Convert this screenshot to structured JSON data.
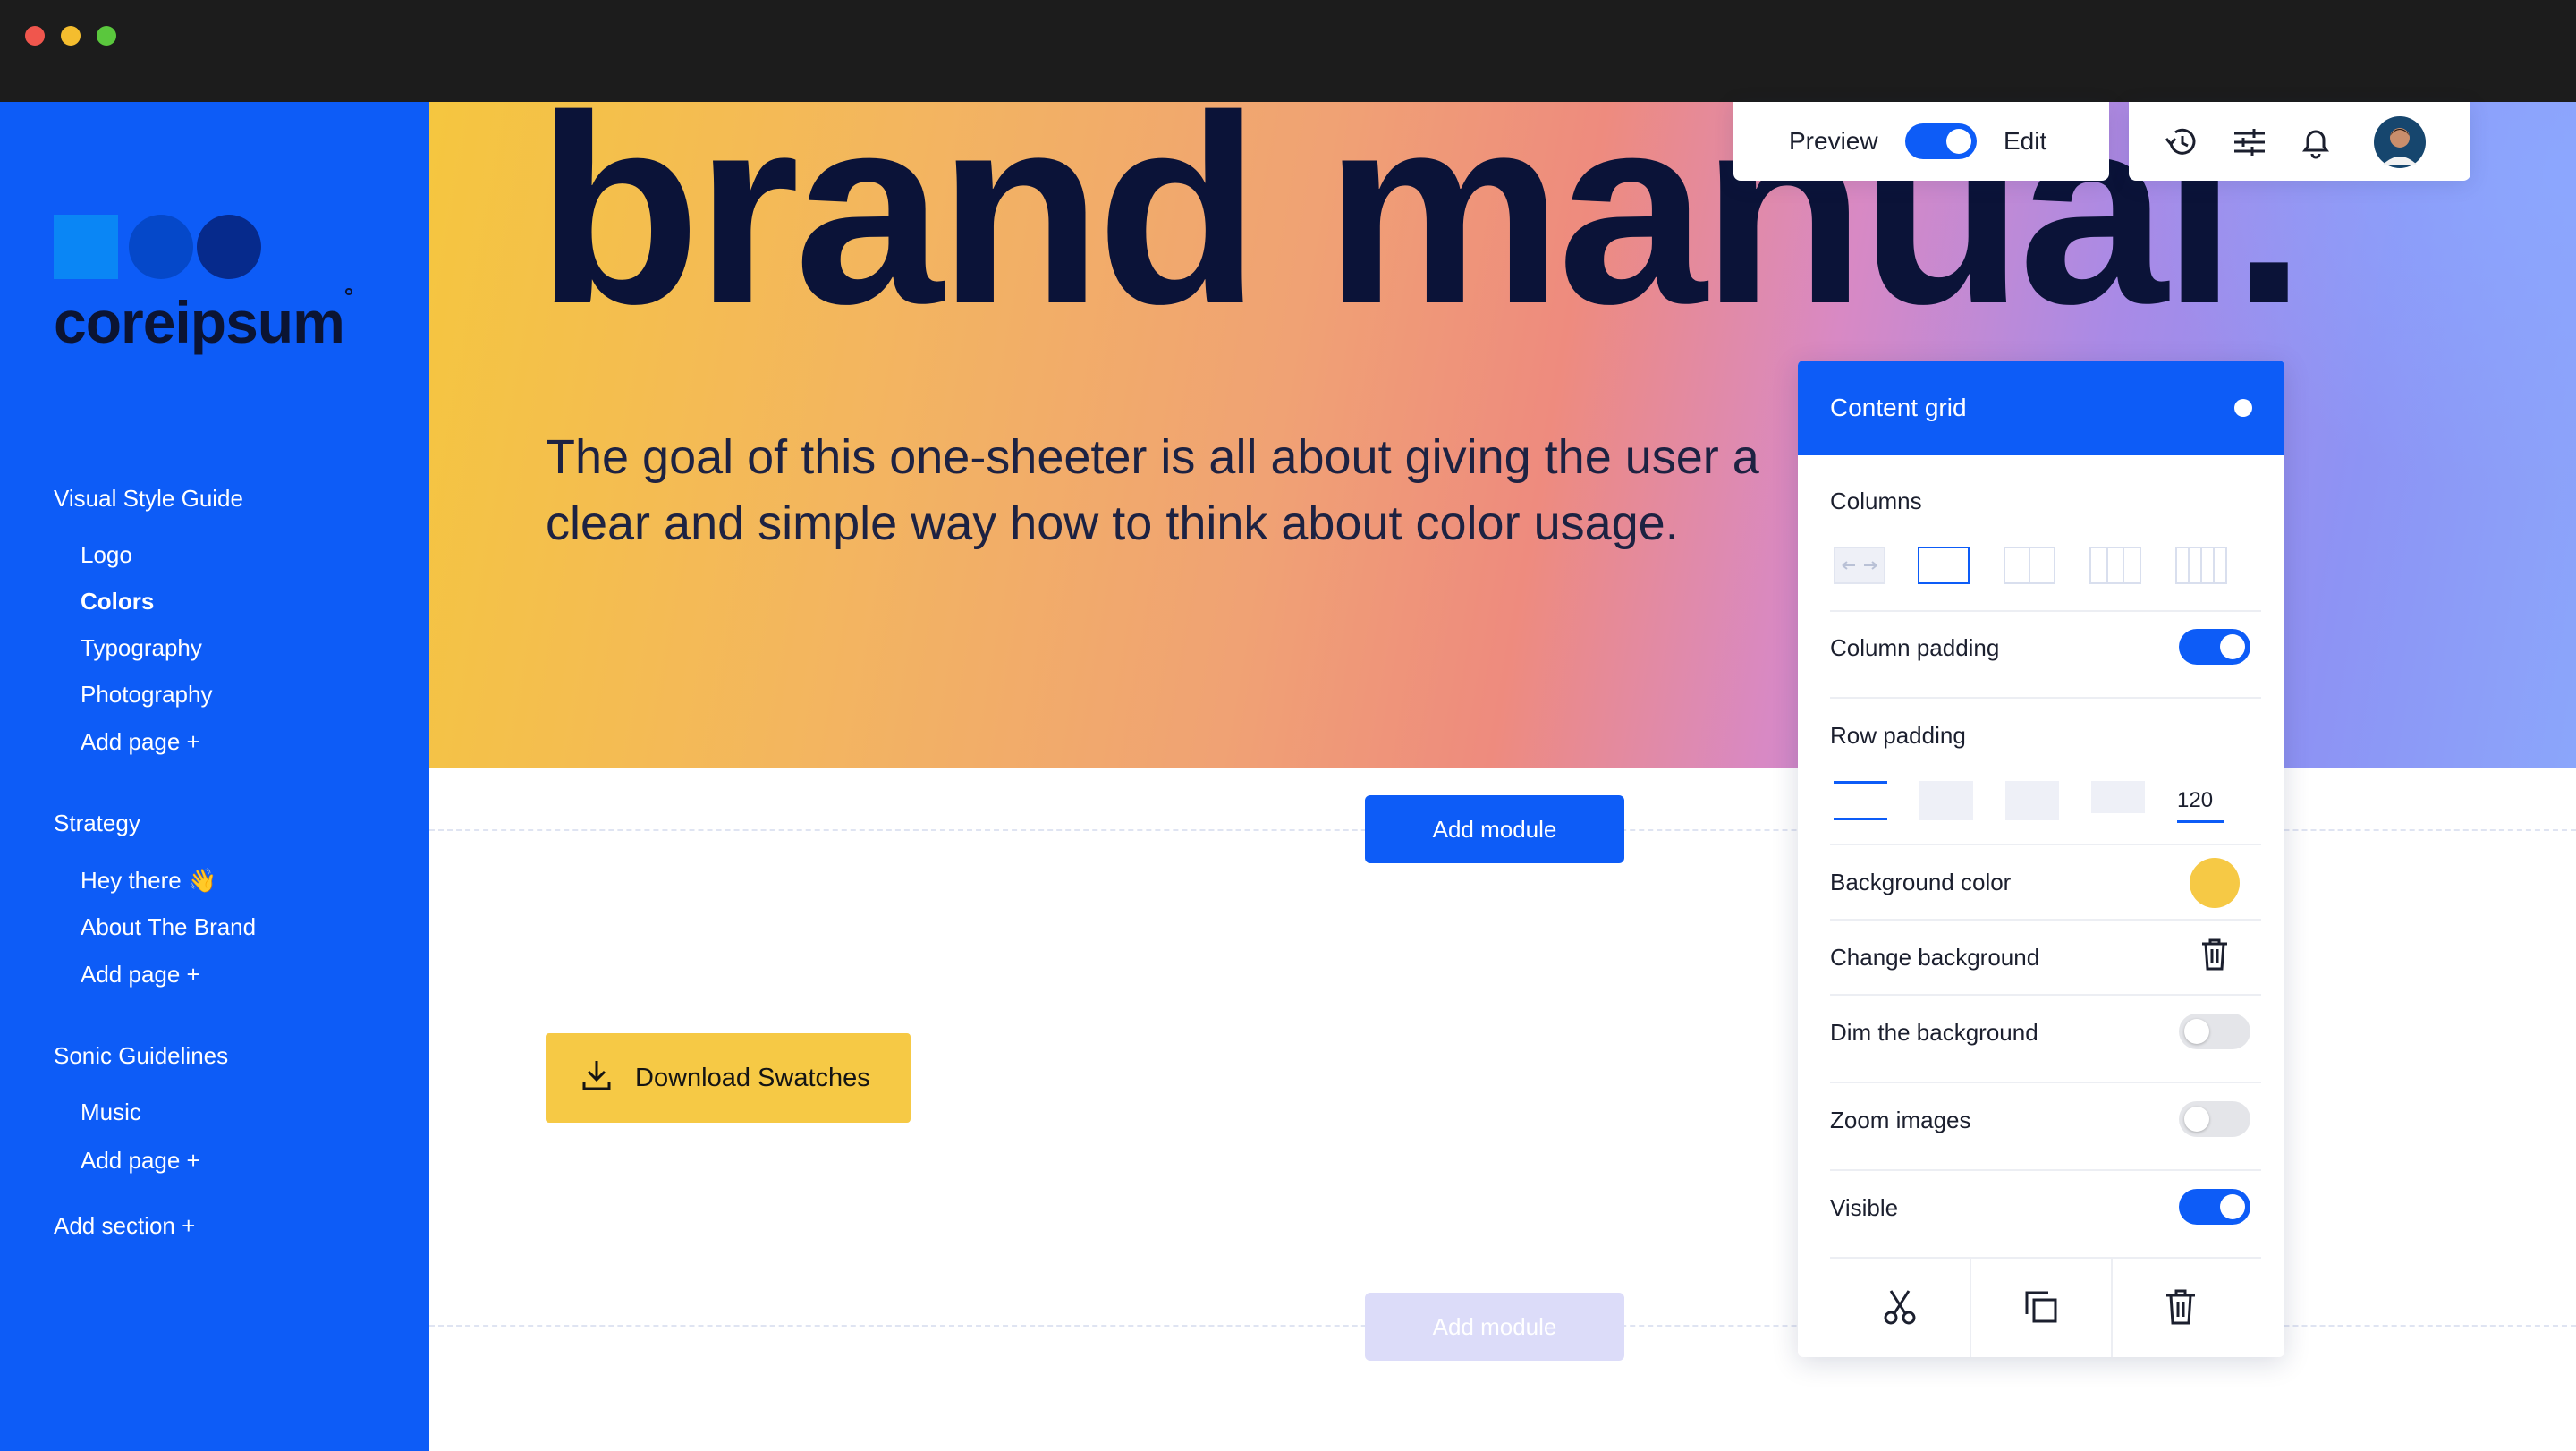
{
  "window": {
    "controls": [
      "close",
      "minimize",
      "maximize"
    ]
  },
  "brand": {
    "name": "coreipsum",
    "mark": "°"
  },
  "sidebar": {
    "sections": [
      {
        "title": "Visual Style Guide",
        "items": [
          "Logo",
          "Colors",
          "Typography",
          "Photography",
          "Add page +"
        ]
      },
      {
        "title": "Strategy",
        "items": [
          "Hey there 👋",
          "About The Brand",
          "Add page +"
        ]
      },
      {
        "title": "Sonic Guidelines",
        "items": [
          "Music",
          "Add page +"
        ]
      }
    ],
    "active_item": "Colors",
    "add_section": "Add section +"
  },
  "hero": {
    "title": "brand manual.",
    "text": "The goal of this one-sheeter is all about giving the user a clear and simple way how to think about color usage."
  },
  "toolbar": {
    "preview_label": "Preview",
    "edit_label": "Edit",
    "mode_toggle_on": true,
    "icons": [
      "history-icon",
      "sliders-icon",
      "bell-icon",
      "avatar"
    ]
  },
  "main": {
    "add_module_label": "Add module",
    "download_label": "Download Swatches"
  },
  "panel": {
    "title": "Content grid",
    "columns_label": "Columns",
    "column_padding_label": "Column padding",
    "column_padding_on": true,
    "row_padding_label": "Row padding",
    "row_padding_value": "120",
    "background_color_label": "Background color",
    "background_color": "#f6c945",
    "change_background_label": "Change background",
    "dim_background_label": "Dim the background",
    "dim_background_on": false,
    "zoom_images_label": "Zoom images",
    "zoom_images_on": false,
    "visible_label": "Visible",
    "visible_on": true,
    "actions": [
      "cut-icon",
      "copy-icon",
      "delete-icon"
    ]
  },
  "colors": {
    "accent": "#0d5cf7",
    "sidebar": "#0d5cf7",
    "title_text": "#0b1338",
    "download_button": "#f6c945",
    "add_module_disabled": "#dcdcf9"
  }
}
